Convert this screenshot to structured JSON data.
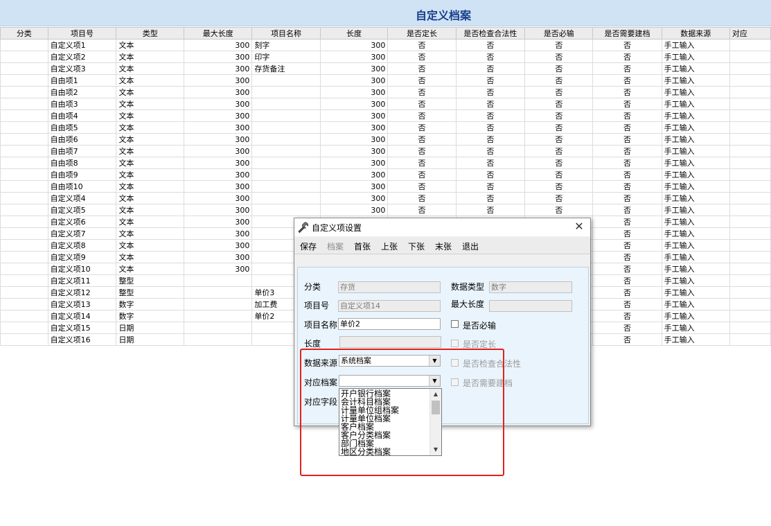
{
  "window": {
    "title": "自定义档案"
  },
  "columns": [
    "分类",
    "项目号",
    "类型",
    "最大长度",
    "项目名称",
    "长度",
    "是否定长",
    "是否检查合法性",
    "是否必输",
    "是否需要建档",
    "数据来源",
    "对应"
  ],
  "rows": [
    {
      "item_no": "自定义项1",
      "type": "文本",
      "max_len": "300",
      "name": "刻字",
      "len": "300",
      "fixed": "否",
      "check": "否",
      "required": "否",
      "archive": "否",
      "source": "手工输入"
    },
    {
      "item_no": "自定义项2",
      "type": "文本",
      "max_len": "300",
      "name": "印字",
      "len": "300",
      "fixed": "否",
      "check": "否",
      "required": "否",
      "archive": "否",
      "source": "手工输入"
    },
    {
      "item_no": "自定义项3",
      "type": "文本",
      "max_len": "300",
      "name": "存货备注",
      "len": "300",
      "fixed": "否",
      "check": "否",
      "required": "否",
      "archive": "否",
      "source": "手工输入"
    },
    {
      "item_no": "自由项1",
      "type": "文本",
      "max_len": "300",
      "name": "",
      "len": "300",
      "fixed": "否",
      "check": "否",
      "required": "否",
      "archive": "否",
      "source": "手工输入"
    },
    {
      "item_no": "自由项2",
      "type": "文本",
      "max_len": "300",
      "name": "",
      "len": "300",
      "fixed": "否",
      "check": "否",
      "required": "否",
      "archive": "否",
      "source": "手工输入"
    },
    {
      "item_no": "自由项3",
      "type": "文本",
      "max_len": "300",
      "name": "",
      "len": "300",
      "fixed": "否",
      "check": "否",
      "required": "否",
      "archive": "否",
      "source": "手工输入"
    },
    {
      "item_no": "自由项4",
      "type": "文本",
      "max_len": "300",
      "name": "",
      "len": "300",
      "fixed": "否",
      "check": "否",
      "required": "否",
      "archive": "否",
      "source": "手工输入"
    },
    {
      "item_no": "自由项5",
      "type": "文本",
      "max_len": "300",
      "name": "",
      "len": "300",
      "fixed": "否",
      "check": "否",
      "required": "否",
      "archive": "否",
      "source": "手工输入"
    },
    {
      "item_no": "自由项6",
      "type": "文本",
      "max_len": "300",
      "name": "",
      "len": "300",
      "fixed": "否",
      "check": "否",
      "required": "否",
      "archive": "否",
      "source": "手工输入"
    },
    {
      "item_no": "自由项7",
      "type": "文本",
      "max_len": "300",
      "name": "",
      "len": "300",
      "fixed": "否",
      "check": "否",
      "required": "否",
      "archive": "否",
      "source": "手工输入"
    },
    {
      "item_no": "自由项8",
      "type": "文本",
      "max_len": "300",
      "name": "",
      "len": "300",
      "fixed": "否",
      "check": "否",
      "required": "否",
      "archive": "否",
      "source": "手工输入"
    },
    {
      "item_no": "自由项9",
      "type": "文本",
      "max_len": "300",
      "name": "",
      "len": "300",
      "fixed": "否",
      "check": "否",
      "required": "否",
      "archive": "否",
      "source": "手工输入"
    },
    {
      "item_no": "自由项10",
      "type": "文本",
      "max_len": "300",
      "name": "",
      "len": "300",
      "fixed": "否",
      "check": "否",
      "required": "否",
      "archive": "否",
      "source": "手工输入"
    },
    {
      "item_no": "自定义项4",
      "type": "文本",
      "max_len": "300",
      "name": "",
      "len": "300",
      "fixed": "否",
      "check": "否",
      "required": "否",
      "archive": "否",
      "source": "手工输入"
    },
    {
      "item_no": "自定义项5",
      "type": "文本",
      "max_len": "300",
      "name": "",
      "len": "300",
      "fixed": "否",
      "check": "否",
      "required": "否",
      "archive": "否",
      "source": "手工输入"
    },
    {
      "item_no": "自定义项6",
      "type": "文本",
      "max_len": "300",
      "name": "",
      "len": "",
      "fixed": "",
      "check": "",
      "required": "",
      "archive": "否",
      "source": "手工输入"
    },
    {
      "item_no": "自定义项7",
      "type": "文本",
      "max_len": "300",
      "name": "",
      "len": "",
      "fixed": "",
      "check": "",
      "required": "",
      "archive": "否",
      "source": "手工输入"
    },
    {
      "item_no": "自定义项8",
      "type": "文本",
      "max_len": "300",
      "name": "",
      "len": "",
      "fixed": "",
      "check": "",
      "required": "",
      "archive": "否",
      "source": "手工输入"
    },
    {
      "item_no": "自定义项9",
      "type": "文本",
      "max_len": "300",
      "name": "",
      "len": "",
      "fixed": "",
      "check": "",
      "required": "",
      "archive": "否",
      "source": "手工输入"
    },
    {
      "item_no": "自定义项10",
      "type": "文本",
      "max_len": "300",
      "name": "",
      "len": "",
      "fixed": "",
      "check": "",
      "required": "",
      "archive": "否",
      "source": "手工输入"
    },
    {
      "item_no": "自定义项11",
      "type": "整型",
      "max_len": "",
      "name": "",
      "len": "",
      "fixed": "",
      "check": "",
      "required": "",
      "archive": "否",
      "source": "手工输入"
    },
    {
      "item_no": "自定义项12",
      "type": "整型",
      "max_len": "",
      "name": "单价3",
      "len": "",
      "fixed": "",
      "check": "",
      "required": "",
      "archive": "否",
      "source": "手工输入"
    },
    {
      "item_no": "自定义项13",
      "type": "数字",
      "max_len": "",
      "name": "加工费",
      "len": "",
      "fixed": "",
      "check": "",
      "required": "",
      "archive": "否",
      "source": "手工输入"
    },
    {
      "item_no": "自定义项14",
      "type": "数字",
      "max_len": "",
      "name": "单价2",
      "len": "",
      "fixed": "",
      "check": "",
      "required": "",
      "archive": "否",
      "source": "手工输入"
    },
    {
      "item_no": "自定义项15",
      "type": "日期",
      "max_len": "",
      "name": "",
      "len": "",
      "fixed": "",
      "check": "",
      "required": "",
      "archive": "否",
      "source": "手工输入"
    },
    {
      "item_no": "自定义项16",
      "type": "日期",
      "max_len": "",
      "name": "",
      "len": "",
      "fixed": "",
      "check": "",
      "required": "",
      "archive": "否",
      "source": "手工输入"
    }
  ],
  "dialog": {
    "title": "自定义项设置",
    "toolbar": {
      "save": "保存",
      "archive": "档案",
      "first": "首张",
      "prev": "上张",
      "next": "下张",
      "last": "末张",
      "exit": "退出"
    },
    "labels": {
      "category": "分类",
      "data_type": "数据类型",
      "item_no": "项目号",
      "max_len": "最大长度",
      "item_name": "项目名称",
      "required": "是否必输",
      "length": "长度",
      "fixed": "是否定长",
      "data_source": "数据来源",
      "check": "是否检查合法性",
      "archive_file": "对应档案",
      "need_archive": "是否需要建档",
      "field": "对应字段"
    },
    "values": {
      "category": "存货",
      "data_type": "数字",
      "item_no": "自定义项14",
      "max_len": "",
      "item_name": "单价2",
      "length": "",
      "data_source": "系统档案",
      "archive_file": ""
    },
    "archive_options": [
      "开户银行档案",
      "会计科目档案",
      "计量单位组档案",
      "计量单位档案",
      "客户档案",
      "客户分类档案",
      "部门档案",
      "地区分类档案"
    ]
  }
}
